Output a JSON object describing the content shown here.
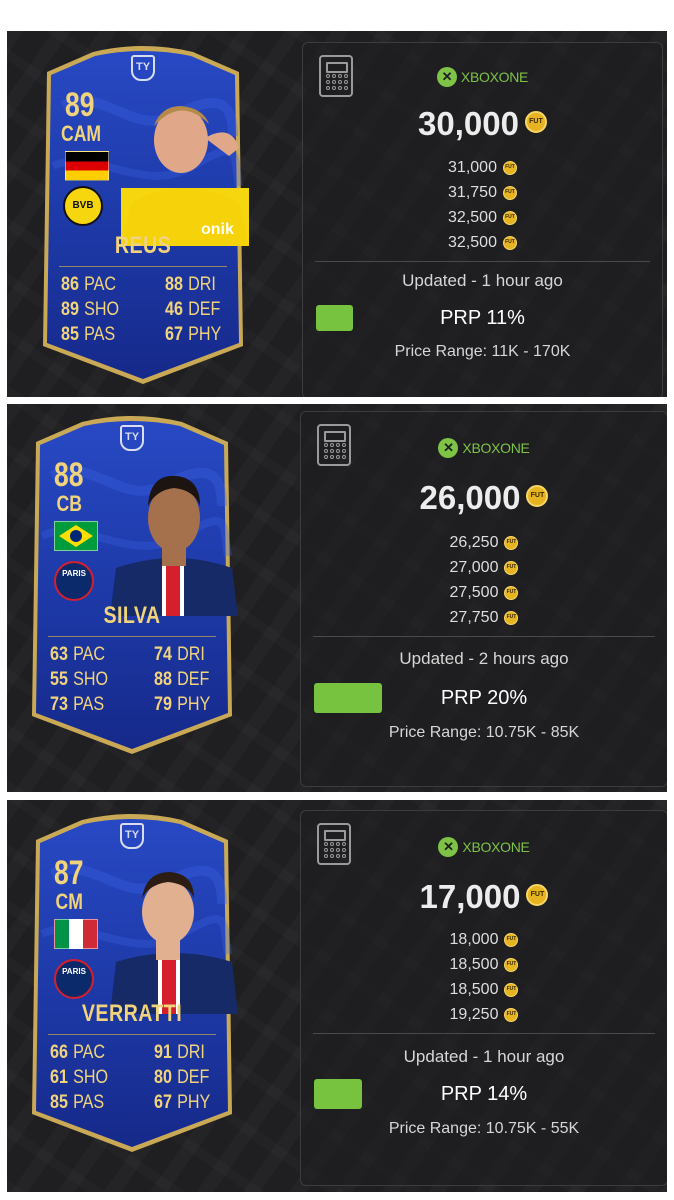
{
  "players": [
    {
      "rating": "89",
      "position": "CAM",
      "name": "REUS",
      "nation": "Germany",
      "club": "BVB",
      "club_badge_text": "BVB",
      "kit_text": "onik",
      "stats": [
        {
          "value": "86",
          "label": "PAC"
        },
        {
          "value": "88",
          "label": "DRI"
        },
        {
          "value": "89",
          "label": "SHO"
        },
        {
          "value": "46",
          "label": "DEF"
        },
        {
          "value": "85",
          "label": "PAS"
        },
        {
          "value": "67",
          "label": "PHY"
        }
      ],
      "platform": "XBOXONE",
      "price": "30,000",
      "other_prices": [
        "31,000",
        "31,750",
        "32,500",
        "32,500"
      ],
      "updated": "Updated - 1 hour ago",
      "prp": "PRP 11%",
      "prp_fraction": 0.11,
      "price_range": "Price Range: 11K - 170K"
    },
    {
      "rating": "88",
      "position": "CB",
      "name": "SILVA",
      "nation": "Brazil",
      "club": "PSG",
      "club_badge_text": "PARIS",
      "stats": [
        {
          "value": "63",
          "label": "PAC"
        },
        {
          "value": "74",
          "label": "DRI"
        },
        {
          "value": "55",
          "label": "SHO"
        },
        {
          "value": "88",
          "label": "DEF"
        },
        {
          "value": "73",
          "label": "PAS"
        },
        {
          "value": "79",
          "label": "PHY"
        }
      ],
      "platform": "XBOXONE",
      "price": "26,000",
      "other_prices": [
        "26,250",
        "27,000",
        "27,500",
        "27,750"
      ],
      "updated": "Updated - 2 hours ago",
      "prp": "PRP 20%",
      "prp_fraction": 0.2,
      "price_range": "Price Range: 10.75K - 85K"
    },
    {
      "rating": "87",
      "position": "CM",
      "name": "VERRATTI",
      "nation": "Italy",
      "club": "PSG",
      "club_badge_text": "PARIS",
      "stats": [
        {
          "value": "66",
          "label": "PAC"
        },
        {
          "value": "91",
          "label": "DRI"
        },
        {
          "value": "61",
          "label": "SHO"
        },
        {
          "value": "80",
          "label": "DEF"
        },
        {
          "value": "85",
          "label": "PAS"
        },
        {
          "value": "67",
          "label": "PHY"
        }
      ],
      "platform": "XBOXONE",
      "price": "17,000",
      "other_prices": [
        "18,000",
        "18,500",
        "18,500",
        "19,250"
      ],
      "updated": "Updated - 1 hour ago",
      "prp": "PRP 14%",
      "prp_fraction": 0.14,
      "price_range": "Price Range: 10.75K - 55K"
    }
  ],
  "coin_label": "FUT",
  "crest_label": "TY",
  "colors": {
    "card_blue": "#1d3aa8",
    "card_dark": "#0f1f78",
    "gold": "#f1d37c",
    "prp_green": "#77c23f",
    "xbox_green": "#7ec246"
  }
}
